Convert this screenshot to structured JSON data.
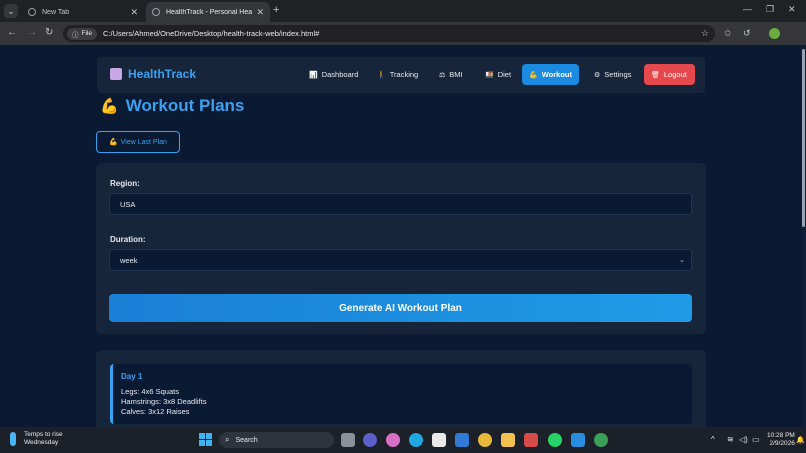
{
  "browser": {
    "tabs": [
      {
        "title": "New Tab",
        "active": false
      },
      {
        "title": "HealthTrack - Personal Health M",
        "active": true
      }
    ],
    "new_tab_label": "+",
    "file_chip": "File",
    "url": "C:/Users/Ahmed/OneDrive/Desktop/health-track-web/index.html#"
  },
  "navbar": {
    "brand": "HealthTrack",
    "items": [
      {
        "label": "Dashboard",
        "icon": "📊",
        "active": false
      },
      {
        "label": "Tracking",
        "icon": "🚶",
        "active": false
      },
      {
        "label": "BMI",
        "icon": "⚖",
        "active": false
      },
      {
        "label": "Diet",
        "icon": "🍱",
        "active": false
      },
      {
        "label": "Workout",
        "icon": "💪",
        "active": true
      },
      {
        "label": "Settings",
        "icon": "⚙",
        "active": false
      },
      {
        "label": "Logout",
        "icon": "🗑",
        "active": false
      }
    ]
  },
  "page": {
    "title": "Workout Plans",
    "title_icon": "💪",
    "view_last_plan": "View Last Plan",
    "form": {
      "region_label": "Region:",
      "region_value": "USA",
      "duration_label": "Duration:",
      "duration_value": "week",
      "generate_button": "Generate AI Workout Plan"
    },
    "plan": {
      "days": [
        {
          "title": "Day 1",
          "exercises": [
            "Legs: 4x6 Squats",
            "Hamstrings: 3x8 Deadlifts",
            "Calves: 3x12 Raises"
          ]
        }
      ]
    }
  },
  "taskbar": {
    "weather_line1": "Temps to rise",
    "weather_line2": "Wednesday",
    "search_placeholder": "Search",
    "time": "10:28 PM",
    "date": "2/9/2026"
  },
  "colors": {
    "accent": "#3aa0f0",
    "page_bg": "#0b1a33",
    "card_bg": "#17253b",
    "logout": "#e5484d"
  }
}
